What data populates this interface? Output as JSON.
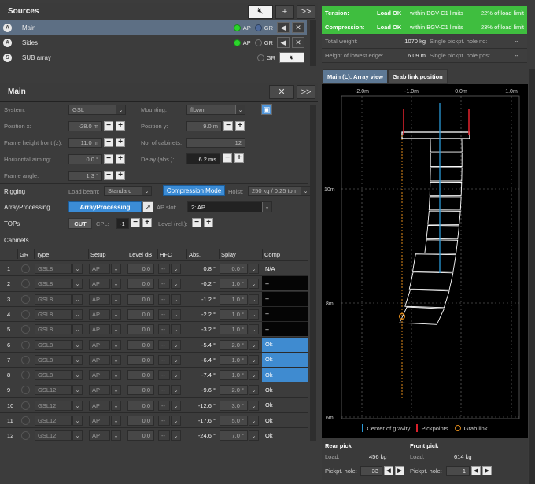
{
  "sources": {
    "title": "Sources",
    "add_label": "+",
    "more_label": ">>",
    "rows": [
      {
        "badge": "A",
        "name": "Main",
        "ap": "AP",
        "gr": "GR"
      },
      {
        "badge": "A",
        "name": "Sides",
        "ap": "AP",
        "gr": "GR"
      },
      {
        "badge": "S",
        "name": "SUB array",
        "ap": "",
        "gr": "GR"
      }
    ]
  },
  "main": {
    "title": "Main",
    "more_label": ">>",
    "system_label": "System:",
    "system_value": "GSL",
    "mounting_label": "Mounting:",
    "mounting_value": "flown",
    "posx_label": "Position x:",
    "posx_value": "-28.0 m",
    "posy_label": "Position y:",
    "posy_value": "9.0 m",
    "frameh_label": "Frame height front (z):",
    "frameh_value": "11.0 m",
    "nocab_label": "No. of cabinets:",
    "nocab_value": "12",
    "haim_label": "Horizontal aiming:",
    "haim_value": "0.0 °",
    "delay_label": "Delay (abs.):",
    "delay_value": "6.2 ms",
    "fangle_label": "Frame angle:",
    "fangle_value": "1.3 °",
    "rigging_label": "Rigging",
    "loadbeam_label": "Load beam:",
    "loadbeam_value": "Standard",
    "compmode_label": "Compression Mode",
    "hoist_label": "Hoist:",
    "hoist_value": "250 kg / 0.25 ton",
    "arrayproc_label": "ArrayProcessing",
    "arrayproc_btn": "ArrayProcessing",
    "apslot_label": "AP slot:",
    "apslot_value": "2: AP",
    "tops_label": "TOPs",
    "cut_label": "CUT",
    "cpl_label": "CPL:",
    "cpl_value": "-1",
    "level_label": "Level (rel.):",
    "cabinets_label": "Cabinets",
    "plus": "+",
    "minus": "−"
  },
  "table": {
    "headers": [
      "GR",
      "Type",
      "Setup",
      "Level dB",
      "HFC",
      "Abs.",
      "Splay",
      "Comp"
    ],
    "rows": [
      {
        "n": "1",
        "type": "GSL8",
        "setup": "AP",
        "level": "0.0",
        "hfc": "--",
        "abs": "0.8 °",
        "splay": "0.0 °",
        "comp": "N/A",
        "style": "none"
      },
      {
        "n": "2",
        "type": "GSL8",
        "setup": "AP",
        "level": "0.0",
        "hfc": "--",
        "abs": "-0.2 °",
        "splay": "1.0 °",
        "comp": "--",
        "style": "blk"
      },
      {
        "n": "3",
        "type": "GSL8",
        "setup": "AP",
        "level": "0.0",
        "hfc": "--",
        "abs": "-1.2 °",
        "splay": "1.0 °",
        "comp": "--",
        "style": "blk"
      },
      {
        "n": "4",
        "type": "GSL8",
        "setup": "AP",
        "level": "0.0",
        "hfc": "--",
        "abs": "-2.2 °",
        "splay": "1.0 °",
        "comp": "--",
        "style": "blk"
      },
      {
        "n": "5",
        "type": "GSL8",
        "setup": "AP",
        "level": "0.0",
        "hfc": "--",
        "abs": "-3.2 °",
        "splay": "1.0 °",
        "comp": "--",
        "style": "blk"
      },
      {
        "n": "6",
        "type": "GSL8",
        "setup": "AP",
        "level": "0.0",
        "hfc": "--",
        "abs": "-5.4 °",
        "splay": "2.0 °",
        "comp": "Ok",
        "style": "blue"
      },
      {
        "n": "7",
        "type": "GSL8",
        "setup": "AP",
        "level": "0.0",
        "hfc": "--",
        "abs": "-6.4 °",
        "splay": "1.0 °",
        "comp": "Ok",
        "style": "blue"
      },
      {
        "n": "8",
        "type": "GSL8",
        "setup": "AP",
        "level": "0.0",
        "hfc": "--",
        "abs": "-7.4 °",
        "splay": "1.0 °",
        "comp": "Ok",
        "style": "blue"
      },
      {
        "n": "9",
        "type": "GSL12",
        "setup": "AP",
        "level": "0.0",
        "hfc": "--",
        "abs": "-9.6 °",
        "splay": "2.0 °",
        "comp": "Ok",
        "style": "none"
      },
      {
        "n": "10",
        "type": "GSL12",
        "setup": "AP",
        "level": "0.0",
        "hfc": "--",
        "abs": "-12.6 °",
        "splay": "3.0 °",
        "comp": "Ok",
        "style": "none"
      },
      {
        "n": "11",
        "type": "GSL12",
        "setup": "AP",
        "level": "0.0",
        "hfc": "--",
        "abs": "-17.6 °",
        "splay": "5.0 °",
        "comp": "Ok",
        "style": "none"
      },
      {
        "n": "12",
        "type": "GSL12",
        "setup": "AP",
        "level": "0.0",
        "hfc": "--",
        "abs": "-24.6 °",
        "splay": "7.0 °",
        "comp": "Ok",
        "style": "none"
      }
    ]
  },
  "status": {
    "tension_label": "Tension:",
    "tension_state": "Load OK",
    "tension_text": "within BGV-C1 limits",
    "tension_pct": "22% of load limit",
    "compression_label": "Compression:",
    "compression_state": "Load OK",
    "compression_text": "within BGV-C1 limits",
    "compression_pct": "23% of load limit",
    "weight_label": "Total weight:",
    "weight_value": "1070 kg",
    "pickpt_label": "Single pickpt. hole no:",
    "pickpt_value": "--",
    "lowest_label": "Height of lowest edge:",
    "lowest_value": "6.09 m",
    "pickpos_label": "Single pickpt. hole pos:",
    "pickpos_value": "--"
  },
  "tabs": [
    "Main (L): Array view",
    "Grab link position"
  ],
  "diagram": {
    "x_ticks": [
      "-2.0m",
      "-1.0m",
      "0.0m",
      "1.0m"
    ],
    "y_ticks": [
      "10m",
      "8m",
      "6m"
    ],
    "legend": [
      "Center of gravity",
      "Pickpoints",
      "Grab link"
    ],
    "colors": {
      "cog": "#2a9ad8",
      "pick": "#d8202a",
      "grab": "#e08a1a"
    }
  },
  "picks": {
    "rear_title": "Rear pick",
    "rear_load_label": "Load:",
    "rear_load_value": "456 kg",
    "rear_hole_label": "Pickpt. hole:",
    "rear_hole_value": "33",
    "front_title": "Front pick",
    "front_load_label": "Load:",
    "front_load_value": "614 kg",
    "front_hole_label": "Pickpt. hole:",
    "front_hole_value": "1"
  }
}
